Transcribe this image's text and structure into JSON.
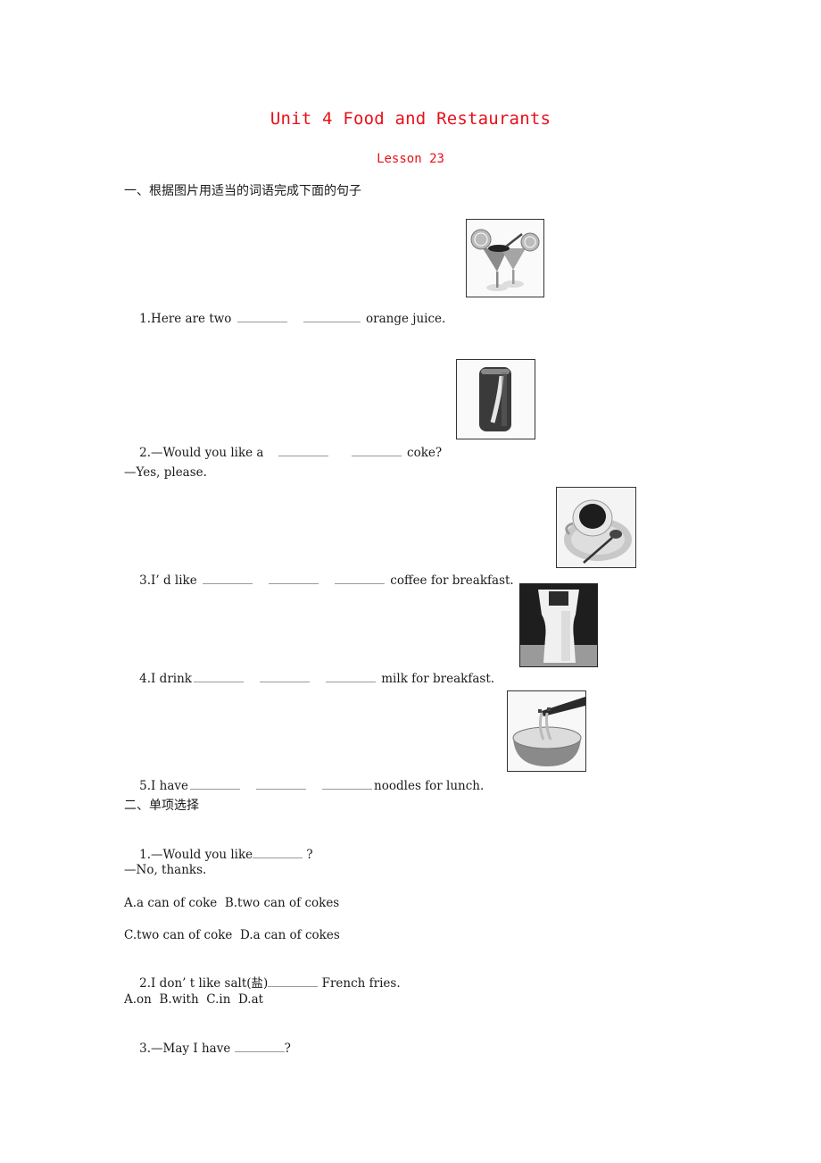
{
  "header": {
    "title": "Unit 4 Food and Restaurants",
    "subtitle": "Lesson 23",
    "accent_color": "#e8101a"
  },
  "section1": {
    "heading": "一、根据图片用适当的词语完成下面的句子",
    "items": [
      {
        "before": "1.Here are two ",
        "after": " orange juice.",
        "blanks": 2,
        "picture": "orange-juice-glasses"
      },
      {
        "before": "2.—Would you like a ",
        "after": " coke?",
        "blanks": 2,
        "picture": "coke-can",
        "reply": "—Yes, please."
      },
      {
        "before": "3.I’ d like ",
        "after": " coffee for breakfast.",
        "blanks": 3,
        "picture": "coffee-cup"
      },
      {
        "before": "4.I drink",
        "after": " milk for breakfast.",
        "blanks": 3,
        "picture": "milk-glass"
      },
      {
        "before": "5.I have",
        "after": "noodles for lunch.",
        "blanks": 3,
        "picture": "noodle-bowl"
      }
    ]
  },
  "section2": {
    "heading": "二、单项选择",
    "questions": [
      {
        "q_before": "1.—Would you like",
        "q_after": " ?",
        "reply": "—No, thanks.",
        "options_line1": "A.a can of coke  B.two can of cokes",
        "options_line2": "C.two can of coke  D.a can of cokes"
      },
      {
        "q_before": "2.I don’ t like salt(盐)",
        "q_after": " French fries.",
        "options_line1": "A.on  B.with  C.in  D.at"
      },
      {
        "q_before": "3.—May I have ",
        "q_after": "?"
      }
    ]
  }
}
